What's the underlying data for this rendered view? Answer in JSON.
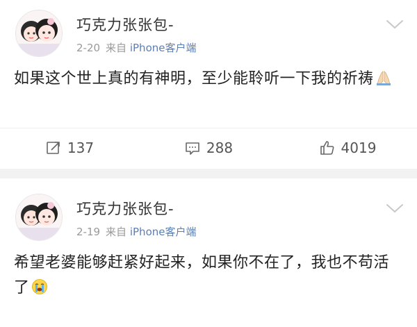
{
  "posts": [
    {
      "username": "巧克力张张包-",
      "date": "2-20",
      "source_prefix": "来自",
      "source": "iPhone客户端",
      "text": "如果这个世上真的有神明，至少能聆听一下我的祈祷",
      "emoji": "pray-icon",
      "reposts": "137",
      "comments": "288",
      "likes": "4019"
    },
    {
      "username": "巧克力张张包-",
      "date": "2-19",
      "source_prefix": "来自",
      "source": "iPhone客户端",
      "text": "希望老婆能够赶紧好起来，如果你不在了，我也不苟活了",
      "emoji": "crying-face-icon"
    }
  ],
  "colors": {
    "source_link": "#5b7fb5",
    "meta_text": "#999999",
    "background": "#f2f2f2"
  }
}
